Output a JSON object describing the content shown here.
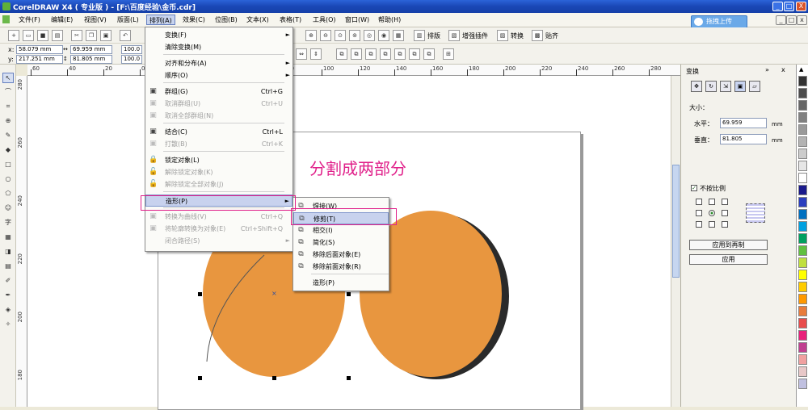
{
  "title_bar": {
    "title": "CorelDRAW X4 ( 专业版 ) - [F:\\百度经验\\金币.cdr]",
    "min": "_",
    "max": "□",
    "close": "X"
  },
  "menu": {
    "items": [
      "文件(F)",
      "编辑(E)",
      "视图(V)",
      "版面(L)",
      "排列(A)",
      "效果(C)",
      "位图(B)",
      "文本(X)",
      "表格(T)",
      "工具(O)",
      "窗口(W)",
      "帮助(H)"
    ],
    "upload": "拖拽上传"
  },
  "toolbar1": {
    "labels": [
      "排版",
      "增强插件",
      "转换",
      "贴齐"
    ]
  },
  "toolbar2": {
    "x_label": "x:",
    "x": "58.079 mm",
    "y_label": "y:",
    "y": "217.251 mm",
    "w": "69.959 mm",
    "h": "81.805 mm",
    "sx": "100.0",
    "sy": "100.0"
  },
  "ruler": {
    "h_ticks": [
      "60",
      "40",
      "20",
      "0",
      "20",
      "40",
      "60",
      "80",
      "100",
      "120",
      "140",
      "160",
      "180",
      "200",
      "220",
      "240",
      "260",
      "280"
    ],
    "v_ticks": [
      "280",
      "260",
      "240",
      "220",
      "200",
      "180"
    ]
  },
  "canvas": {
    "heading": "分割成两部分",
    "coin_color": "#e8963f",
    "heading_color": "#e0208a"
  },
  "arrange_menu": {
    "items": [
      {
        "label": "变换(F)",
        "key": "",
        "arrow": "►",
        "disabled": false,
        "icon": ""
      },
      {
        "label": "清除变换(M)",
        "key": "",
        "arrow": "",
        "disabled": false,
        "icon": ""
      },
      {
        "label": "对齐和分布(A)",
        "key": "",
        "arrow": "►",
        "disabled": false,
        "icon": ""
      },
      {
        "label": "顺序(O)",
        "key": "",
        "arrow": "►",
        "disabled": false,
        "icon": ""
      },
      {
        "label": "群组(G)",
        "key": "Ctrl+G",
        "arrow": "",
        "disabled": false,
        "icon": "group"
      },
      {
        "label": "取消群组(U)",
        "key": "Ctrl+U",
        "arrow": "",
        "disabled": true,
        "icon": "ungroup"
      },
      {
        "label": "取消全部群组(N)",
        "key": "",
        "arrow": "",
        "disabled": true,
        "icon": "ungroup-all"
      },
      {
        "label": "结合(C)",
        "key": "Ctrl+L",
        "arrow": "",
        "disabled": false,
        "icon": "combine"
      },
      {
        "label": "打散(B)",
        "key": "Ctrl+K",
        "arrow": "",
        "disabled": true,
        "icon": "break"
      },
      {
        "label": "锁定对象(L)",
        "key": "",
        "arrow": "",
        "disabled": false,
        "icon": "lock"
      },
      {
        "label": "解除锁定对象(K)",
        "key": "",
        "arrow": "",
        "disabled": true,
        "icon": "unlock"
      },
      {
        "label": "解除锁定全部对象(J)",
        "key": "",
        "arrow": "",
        "disabled": true,
        "icon": "unlock-all"
      },
      {
        "label": "造形(P)",
        "key": "",
        "arrow": "►",
        "disabled": false,
        "icon": ""
      },
      {
        "label": "转换为曲线(V)",
        "key": "Ctrl+Q",
        "arrow": "",
        "disabled": true,
        "icon": "curve"
      },
      {
        "label": "将轮廓转换为对象(E)",
        "key": "Ctrl+Shift+Q",
        "arrow": "",
        "disabled": true,
        "icon": "outline"
      },
      {
        "label": "闭合路径(S)",
        "key": "",
        "arrow": "►",
        "disabled": true,
        "icon": ""
      }
    ]
  },
  "shaping_menu": {
    "items": [
      "焊接(W)",
      "修剪(T)",
      "相交(I)",
      "简化(S)",
      "移除后面对象(E)",
      "移除前面对象(R)",
      "造形(P)"
    ]
  },
  "docker": {
    "tab": "变换",
    "size_label": "大小：",
    "h_label": "水平：",
    "h_value": "69.959",
    "v_label": "垂直：",
    "v_value": "81.805",
    "unit": "mm",
    "nonprop": "不按比例",
    "apply_dup": "应用到再制",
    "apply": "应用"
  },
  "palette": {
    "colors": [
      "#333333",
      "#4d4d4d",
      "#666666",
      "#808080",
      "#999999",
      "#b3b3b3",
      "#cccccc",
      "#e6e6e6",
      "#ffffff",
      "#1a1a8c",
      "#2b3fbf",
      "#0070c0",
      "#00a0e0",
      "#00a060",
      "#60c040",
      "#c0e040",
      "#ffff00",
      "#ffcc00",
      "#ff9900",
      "#e87c3c",
      "#e84c4c",
      "#e8207a",
      "#c04090",
      "#f0a0a0",
      "#e8c8c8",
      "#c0c0e0"
    ]
  }
}
